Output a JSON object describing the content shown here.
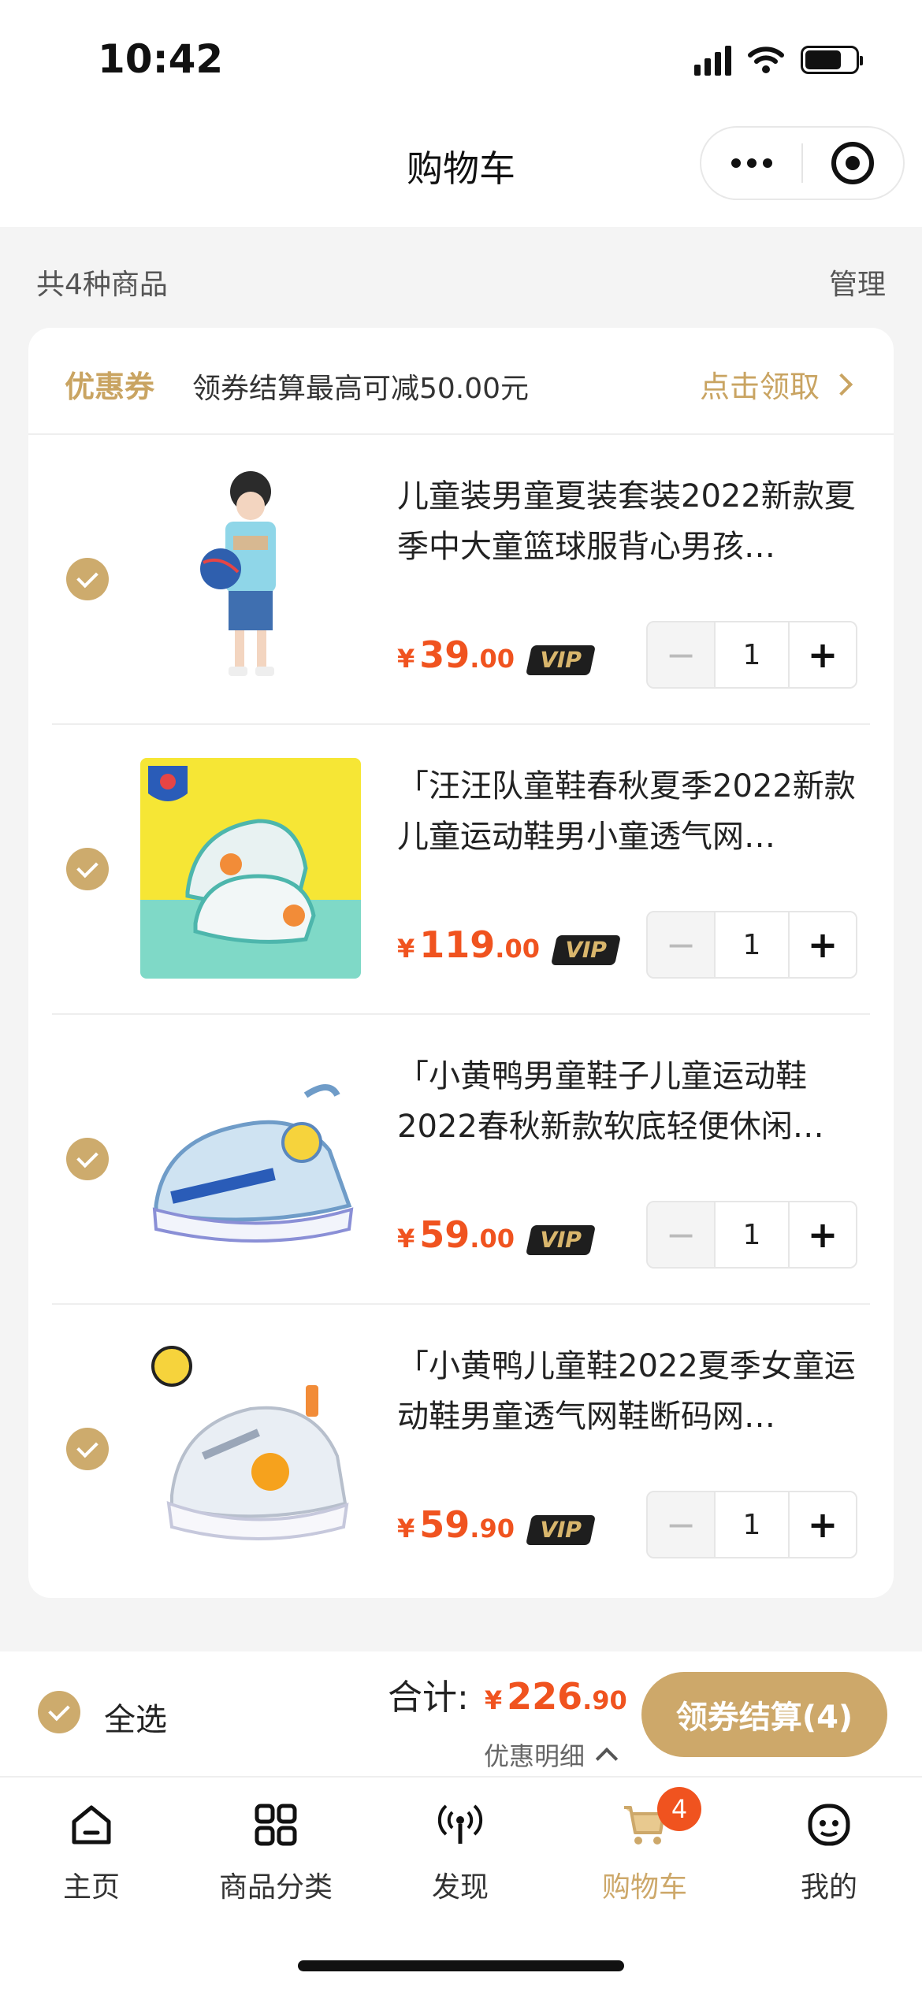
{
  "status_bar": {
    "time": "10:42"
  },
  "nav": {
    "title": "购物车"
  },
  "summary": {
    "count_text": "共4种商品",
    "manage": "管理"
  },
  "coupon": {
    "label": "优惠券",
    "desc": "领券结算最高可减50.00元",
    "claim": "点击领取"
  },
  "items": [
    {
      "title": "儿童装男童夏装套装2022新款夏季中大童篮球服背心男孩…",
      "price_currency": "¥",
      "price_int": "39",
      "price_dec": ".00",
      "vip": "VIP",
      "qty": "1",
      "minus": "−",
      "plus": "+"
    },
    {
      "title": "「汪汪队童鞋春秋夏季2022新款儿童运动鞋男小童透气网…",
      "price_currency": "¥",
      "price_int": "119",
      "price_dec": ".00",
      "vip": "VIP",
      "qty": "1",
      "minus": "−",
      "plus": "+"
    },
    {
      "title": "「小黄鸭男童鞋子儿童运动鞋2022春秋新款软底轻便休闲…",
      "price_currency": "¥",
      "price_int": "59",
      "price_dec": ".00",
      "vip": "VIP",
      "qty": "1",
      "minus": "−",
      "plus": "+"
    },
    {
      "title": "「小黄鸭儿童鞋2022夏季女童运动鞋男童透气网鞋断码网…",
      "price_currency": "¥",
      "price_int": "59",
      "price_dec": ".90",
      "vip": "VIP",
      "qty": "1",
      "minus": "−",
      "plus": "+"
    }
  ],
  "checkout": {
    "select_all": "全选",
    "total_label": "合计:",
    "total_currency": "¥",
    "total_int": "226",
    "total_dec": ".90",
    "discount_detail": "优惠明细",
    "button": "领券结算(4)"
  },
  "tabbar": [
    {
      "label": "主页",
      "icon": "home-icon"
    },
    {
      "label": "商品分类",
      "icon": "grid-icon"
    },
    {
      "label": "发现",
      "icon": "broadcast-icon"
    },
    {
      "label": "购物车",
      "icon": "cart-icon",
      "badge": "4",
      "active": true
    },
    {
      "label": "我的",
      "icon": "smile-icon"
    }
  ],
  "colors": {
    "accent": "#cda86a",
    "price": "#f0531f"
  }
}
